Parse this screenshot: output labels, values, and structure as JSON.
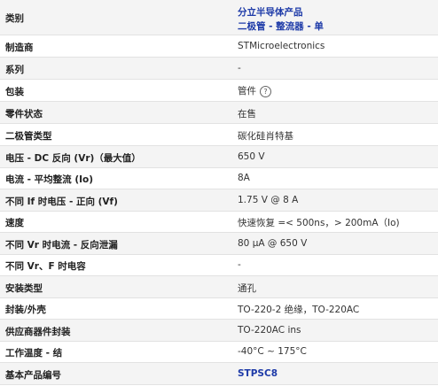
{
  "rows": [
    {
      "label": "类别",
      "value_line1": "分立半导体产品",
      "value_line2": "二极管 - 整流器 - 单"
    },
    {
      "label": "制造商",
      "value": "STMicroelectronics"
    },
    {
      "label": "系列",
      "value": "-"
    },
    {
      "label": "包装",
      "value": "管件",
      "help_icon": "?"
    },
    {
      "label": "零件状态",
      "value": "在售"
    },
    {
      "label": "二极管类型",
      "value": "碳化硅肖特基"
    },
    {
      "label": "电压 - DC 反向 (Vr)（最大值）",
      "value": "650 V"
    },
    {
      "label": "电流 - 平均整流 (Io)",
      "value": "8A"
    },
    {
      "label": "不同 If 时电压 - 正向 (Vf)",
      "value": "1.75 V @ 8 A"
    },
    {
      "label": "速度",
      "value": "快速恢复 =< 500ns，> 200mA（Io)"
    },
    {
      "label": "不同 Vr 时电流 - 反向泄漏",
      "value": "80 µA @ 650 V"
    },
    {
      "label": "不同 Vr、F 时电容",
      "value": "-"
    },
    {
      "label": "安装类型",
      "value": "通孔"
    },
    {
      "label": "封装/外壳",
      "value": "TO-220-2 绝缘，TO-220AC"
    },
    {
      "label": "供应商器件封装",
      "value": "TO-220AC ins"
    },
    {
      "label": "工作温度 - 结",
      "value": "-40°C ~ 175°C"
    },
    {
      "label": "基本产品编号",
      "value": "STPSC8"
    }
  ]
}
